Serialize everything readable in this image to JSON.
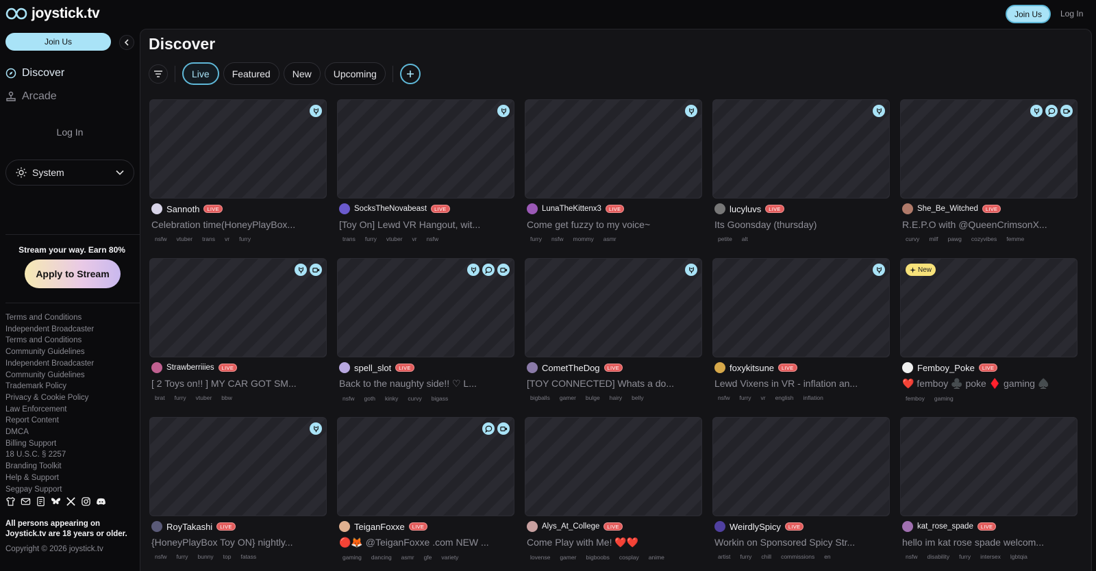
{
  "brand": {
    "name": "joystick.tv",
    "accent": "#a9e3f7",
    "live_color": "#e35d5d"
  },
  "header": {
    "join_label": "Join Us",
    "login_label": "Log In"
  },
  "sidebar": {
    "join_label": "Join Us",
    "nav": [
      {
        "label": "Discover",
        "icon": "compass-icon"
      },
      {
        "label": "Arcade",
        "icon": "joystick-icon"
      }
    ],
    "login_label": "Log In",
    "theme_label": "System",
    "promo_text": "Stream your way. Earn 80%",
    "apply_label": "Apply to Stream",
    "footer_links": [
      "Terms and Conditions",
      "Independent Broadcaster",
      "Terms and Conditions",
      "Community Guidelines",
      "Independent Broadcaster",
      "Community Guidelines",
      "Trademark Policy",
      "Privacy & Cookie Policy",
      "Law Enforcement",
      "Report Content",
      "DMCA",
      "Billing Support",
      "18 U.S.C. § 2257",
      "Branding Toolkit",
      "Help & Support",
      "Segpay Support"
    ],
    "age_note": "All persons appearing on Joystick.tv are 18 years or older.",
    "copyright": "Copyright © 2026 joystick.tv"
  },
  "main": {
    "title": "Discover",
    "tabs": [
      "Live",
      "Featured",
      "New",
      "Upcoming"
    ],
    "active_tab": "Live"
  },
  "live_badge": "LIVE",
  "new_badge": "New",
  "streams": [
    {
      "name": "Sannoth",
      "title": "Celebration time(HoneyPlayBox...",
      "tags": [
        "nsfw",
        "vtuber",
        "trans",
        "vr",
        "furry"
      ],
      "badges": [
        "toy"
      ],
      "avatar": "#d8d4e8"
    },
    {
      "name": "SocksTheNovabeast",
      "title": "[Toy On] Lewd VR Hangout, wit...",
      "tags": [
        "trans",
        "furry",
        "vtuber",
        "vr",
        "nsfw"
      ],
      "badges": [
        "toy"
      ],
      "avatar": "#6a5acd",
      "small": true
    },
    {
      "name": "LunaTheKittenx3",
      "title": "Come get fuzzy to my voice~",
      "tags": [
        "furry",
        "nsfw",
        "mommy",
        "asmr"
      ],
      "badges": [
        "toy"
      ],
      "avatar": "#9b59b6",
      "small": true
    },
    {
      "name": "lucyluvs",
      "title": "Its Goonsday (thursday)",
      "tags": [
        "petite",
        "alt"
      ],
      "badges": [
        "toy"
      ],
      "avatar": "#777777"
    },
    {
      "name": "She_Be_Witched",
      "title": "R.E.P.O with @QueenCrimsonX...",
      "tags": [
        "curvy",
        "milf",
        "pawg",
        "cozyvibes",
        "femme"
      ],
      "badges": [
        "toy",
        "chat",
        "video"
      ],
      "avatar": "#b07a6a",
      "small": true
    },
    {
      "name": "Strawberriiies",
      "title": "[ 2 Toys on!! ] MY CAR GOT SM...",
      "tags": [
        "brat",
        "furry",
        "vtuber",
        "bbw"
      ],
      "badges": [
        "toy",
        "video"
      ],
      "avatar": "#c06090",
      "small": true
    },
    {
      "name": "spell_slot",
      "title": "Back to the naughty side!! ♡ L...",
      "tags": [
        "nsfw",
        "goth",
        "kinky",
        "curvy",
        "bigass"
      ],
      "badges": [
        "toy",
        "chat",
        "video"
      ],
      "avatar": "#b8a8e0"
    },
    {
      "name": "CometTheDog",
      "title": "[TOY CONNECTED] Whats a do...",
      "tags": [
        "bigballs",
        "gamer",
        "bulge",
        "hairy",
        "belly"
      ],
      "badges": [
        "toy"
      ],
      "avatar": "#8a7aa8"
    },
    {
      "name": "foxykitsune",
      "title": "Lewd Vixens in VR - inflation an...",
      "tags": [
        "nsfw",
        "furry",
        "vr",
        "english",
        "inflation"
      ],
      "badges": [
        "toy"
      ],
      "avatar": "#d6a84a"
    },
    {
      "name": "Femboy_Poke",
      "title": "❤️ femboy ♣️ poke ♦️ gaming ♠️",
      "tags": [
        "femboy",
        "gaming"
      ],
      "badges": [],
      "new": true,
      "avatar": "#f0f0f0"
    },
    {
      "name": "RoyTakashi",
      "title": "{HoneyPlayBox Toy ON} nightly...",
      "tags": [
        "nsfw",
        "furry",
        "bunny",
        "top",
        "fatass"
      ],
      "badges": [
        "toy"
      ],
      "avatar": "#5a5a78"
    },
    {
      "name": "TeiganFoxxe",
      "title": "🔴🦊 @TeiganFoxxe .com NEW ...",
      "tags": [
        "gaming",
        "dancing",
        "asmr",
        "gfe",
        "variety"
      ],
      "badges": [
        "chat",
        "video"
      ],
      "avatar": "#e0b090"
    },
    {
      "name": "Alys_At_College",
      "title": "Come Play with Me! ❤️❤️",
      "tags": [
        "lovense",
        "gamer",
        "bigboobs",
        "cosplay",
        "anime"
      ],
      "badges": [],
      "avatar": "#c8a0a0",
      "small": true
    },
    {
      "name": "WeirdlySpicy",
      "title": "Workin on Sponsored Spicy Str...",
      "tags": [
        "artist",
        "furry",
        "chill",
        "commissions",
        "en"
      ],
      "badges": [],
      "avatar": "#5040a0"
    },
    {
      "name": "kat_rose_spade",
      "title": "hello im kat rose spade welcom...",
      "tags": [
        "nsfw",
        "disability",
        "furry",
        "intersex",
        "lgbtqia"
      ],
      "badges": [],
      "avatar": "#a070b0",
      "small": true
    }
  ]
}
